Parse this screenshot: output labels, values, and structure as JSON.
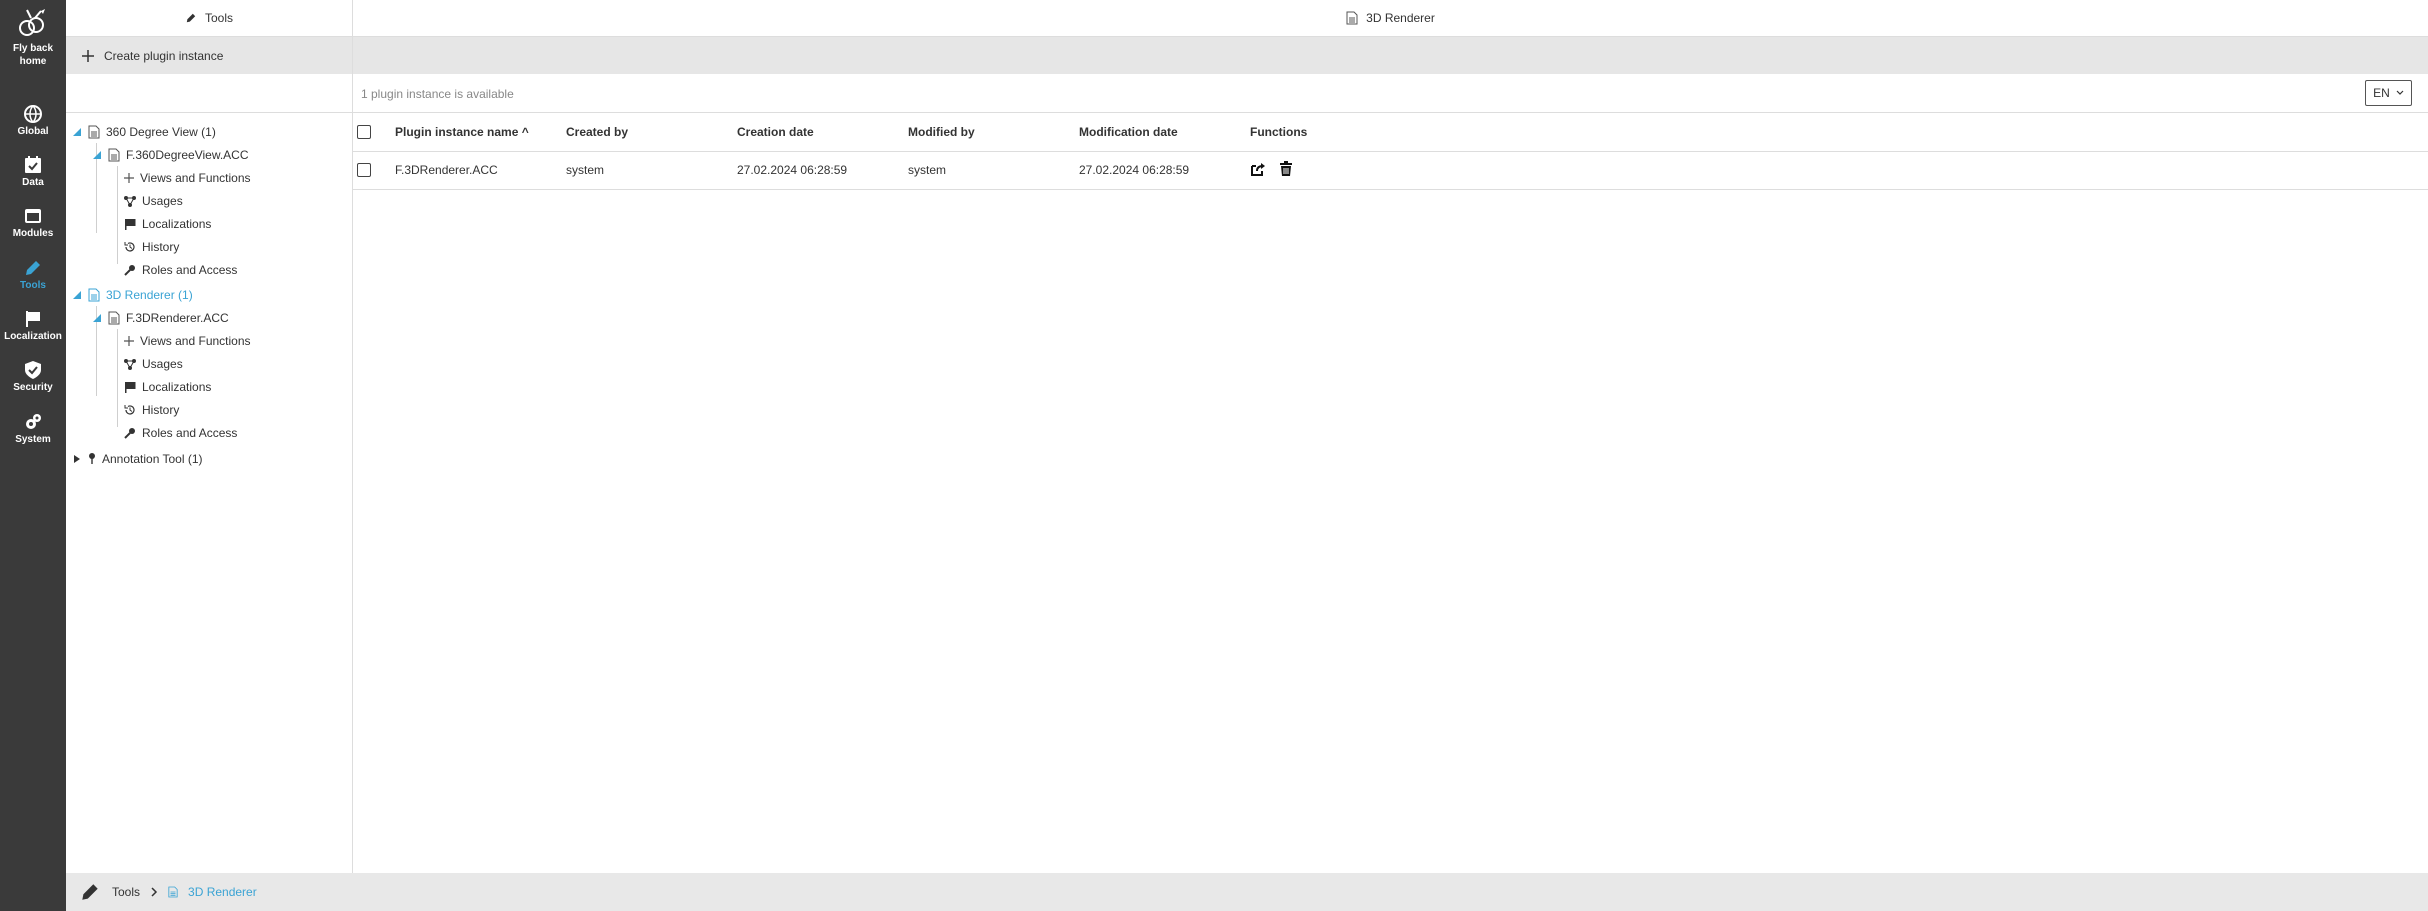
{
  "nav": {
    "home_label_line1": "Fly back",
    "home_label_line2": "home",
    "items": [
      {
        "label": "Global"
      },
      {
        "label": "Data"
      },
      {
        "label": "Modules"
      },
      {
        "label": "Tools"
      },
      {
        "label": "Localization"
      },
      {
        "label": "Security"
      },
      {
        "label": "System"
      }
    ],
    "active": "Tools",
    "active_color": "#3aa3d4",
    "background": "#3a3a3a"
  },
  "tree_panel": {
    "title": "Tools",
    "create_label": "Create plugin instance",
    "nodes": [
      {
        "label": "360 Degree View (1)"
      },
      {
        "label": "F.360DegreeView.ACC"
      },
      {
        "label": "Views and Functions"
      },
      {
        "label": "Usages"
      },
      {
        "label": "Localizations"
      },
      {
        "label": "History"
      },
      {
        "label": "Roles and Access"
      },
      {
        "label": "3D Renderer (1)"
      },
      {
        "label": "F.3DRenderer.ACC"
      },
      {
        "label": "Views and Functions"
      },
      {
        "label": "Usages"
      },
      {
        "label": "Localizations"
      },
      {
        "label": "History"
      },
      {
        "label": "Roles and Access"
      },
      {
        "label": "Annotation Tool (1)"
      }
    ]
  },
  "main": {
    "title": "3D Renderer",
    "info": "1 plugin instance is available",
    "language": "EN",
    "columns": [
      "Plugin instance name",
      "Created by",
      "Creation date",
      "Modified by",
      "Modification date",
      "Functions"
    ],
    "sort_indicator": "^",
    "rows": [
      {
        "name": "F.3DRenderer.ACC",
        "created_by": "system",
        "creation_date": "27.02.2024 06:28:59",
        "modified_by": "system",
        "modification_date": "27.02.2024 06:28:59"
      }
    ]
  },
  "footer": {
    "crumb1": "Tools",
    "crumb2": "3D Renderer"
  }
}
